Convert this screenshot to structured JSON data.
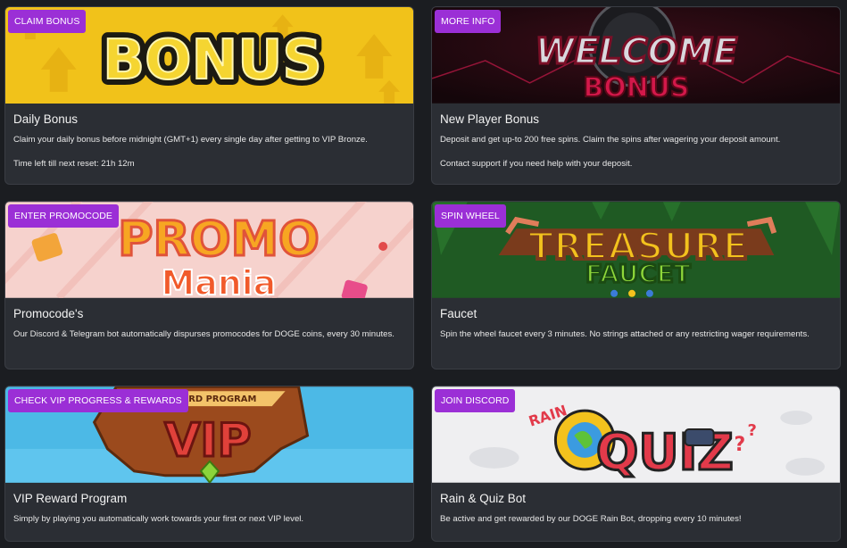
{
  "cards": [
    {
      "button": "CLAIM BONUS",
      "title": "Daily Bonus",
      "desc": "Claim your daily bonus before midnight (GMT+1) every single day after getting to VIP Bronze.",
      "extra": "Time left till next reset: 21h 12m",
      "art_text": "BONUS"
    },
    {
      "button": "MORE INFO",
      "title": "New Player Bonus",
      "desc": "Deposit and get up-to 200 free spins. Claim the spins after wagering your deposit amount.",
      "extra": "Contact support if you need help with your deposit.",
      "art_text": "WELCOME",
      "art_text2": "BONUS"
    },
    {
      "button": "ENTER PROMOCODE",
      "title": "Promocode's",
      "desc": "Our Discord & Telegram bot automatically dispurses promocodes for DOGE coins, every 30 minutes.",
      "art_text": "PROMO",
      "art_text2": "Mania"
    },
    {
      "button": "SPIN WHEEL",
      "title": "Faucet",
      "desc": "Spin the wheel faucet every 3 minutes. No strings attached or any restricting wager requirements.",
      "art_text": "TREASURE",
      "art_text2": "FAUCET"
    },
    {
      "button": "CHECK VIP PROGRESS & REWARDS",
      "title": "VIP Reward Program",
      "desc": "Simply by playing you automatically work towards your first or next VIP level.",
      "art_text": "VIP",
      "art_text2": "REWARD PROGRAM"
    },
    {
      "button": "JOIN DISCORD",
      "title": "Rain & Quiz Bot",
      "desc": "Be active and get rewarded by our DOGE Rain Bot, dropping every 10 minutes!",
      "art_text": "QUIZ",
      "art_text2": "RAIN"
    }
  ],
  "colors": {
    "accent": "#9b2fd6",
    "card_bg": "#2b2e34",
    "page_bg": "#1b1d21"
  }
}
